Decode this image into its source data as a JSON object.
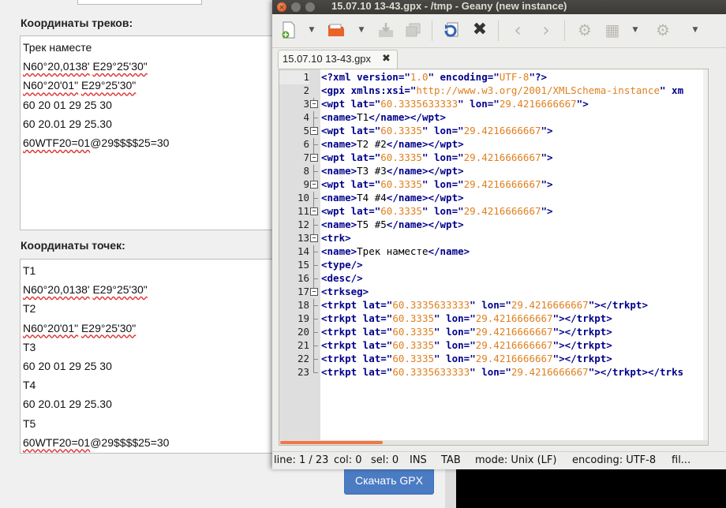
{
  "webpage": {
    "tracks_title": "Координаты треков:",
    "track_lines": [
      "Трек наместе",
      "N60°20,0138' E29°25'30\"",
      "N60°20'01\" E29°25'30\"",
      "60 20 01 29 25 30",
      "60 20.01 29 25.30",
      "60WTF20=01@29$$$$25=30"
    ],
    "points_title": "Координаты точек:",
    "point_lines": [
      "T1",
      "N60°20,0138' E29°25'30\"",
      "T2",
      "N60°20'01\" E29°25'30\"",
      "T3",
      "60 20 01 29 25 30",
      "T4",
      "60 20.01 29 25.30",
      "T5",
      "60WTF20=01@29$$$$25=30"
    ],
    "download_button": "Скачать GPX"
  },
  "geany": {
    "window_title": "15.07.10 13-43.gpx - /tmp - Geany (new instance)",
    "tab_label": "15.07.10 13-43.gpx",
    "tab_close": "✖",
    "toolbar_icons": [
      "new-file",
      "open-file",
      "save-file",
      "save-all",
      "reload",
      "close-file",
      "back",
      "forward",
      "compile",
      "build",
      "execute"
    ],
    "line_numbers": [
      "1",
      "2",
      "3",
      "4",
      "5",
      "6",
      "7",
      "8",
      "9",
      "10",
      "11",
      "12",
      "13",
      "14",
      "15",
      "16",
      "17",
      "18",
      "19",
      "20",
      "21",
      "22",
      "23"
    ],
    "code_lines": [
      "<?xml version=\"1.0\" encoding=\"UTF-8\"?>",
      "<gpx xmlns:xsi=\"http://www.w3.org/2001/XMLSchema-instance\" xm",
      "<wpt lat=\"60.3335633333\" lon=\"29.4216666667\">",
      "<name>T1</name></wpt>",
      "<wpt lat=\"60.3335\" lon=\"29.4216666667\">",
      "<name>T2 #2</name></wpt>",
      "<wpt lat=\"60.3335\" lon=\"29.4216666667\">",
      "<name>T3 #3</name></wpt>",
      "<wpt lat=\"60.3335\" lon=\"29.4216666667\">",
      "<name>T4 #4</name></wpt>",
      "<wpt lat=\"60.3335\" lon=\"29.4216666667\">",
      "<name>T5 #5</name></wpt>",
      "<trk>",
      "<name>Трек наместе</name>",
      "<type/>",
      "<desc/>",
      "<trkseg>",
      "<trkpt lat=\"60.3335633333\" lon=\"29.4216666667\"></trkpt>",
      "<trkpt lat=\"60.3335\" lon=\"29.4216666667\"></trkpt>",
      "<trkpt lat=\"60.3335\" lon=\"29.4216666667\"></trkpt>",
      "<trkpt lat=\"60.3335\" lon=\"29.4216666667\"></trkpt>",
      "<trkpt lat=\"60.3335\" lon=\"29.4216666667\"></trkpt>",
      "<trkpt lat=\"60.3335633333\" lon=\"29.4216666667\"></trkpt></trks"
    ],
    "status": {
      "line": "line: 1 / 23",
      "col": "col: 0",
      "sel": "sel: 0",
      "ins": "INS",
      "tab": "TAB",
      "mode": "mode: Unix (LF)",
      "encoding": "encoding: UTF-8",
      "filetype": "fil..."
    },
    "colors": {
      "tag": "#00008b",
      "string": "#e08020",
      "accent": "#f07746"
    }
  }
}
